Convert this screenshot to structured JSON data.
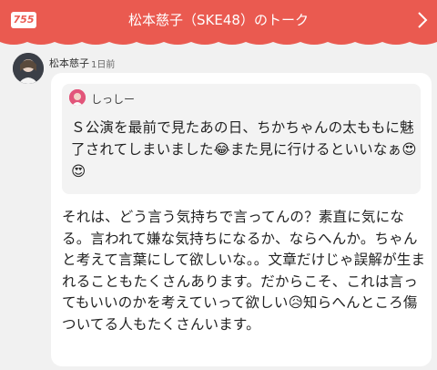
{
  "header": {
    "logo_text": "755",
    "title": "松本慈子（SKE48）のトーク"
  },
  "message": {
    "sender": "松本慈子",
    "time": "1日前",
    "quote": {
      "name": "しっしー",
      "text": "Ｓ公演を最前で見たあの日、ちかちゃんの太ももに魅了されてしまいました😂また見に行けるといいなぁ😍😍"
    },
    "reply_text": "それは、どう言う気持ちで言ってんの？素直に気になる。言われて嫌な気持ちになるか、ならへんか。ちゃんと考えて言葉にして欲しいな。。文章だけじゃ誤解が生まれることもたくさんあります。だからこそ、これは言ってもいいのかを考えていって欲しい😥知らへんところ傷ついてる人もたくさんいます。"
  },
  "colors": {
    "header_bg": "#ea5a50",
    "background": "#f1f1f1",
    "bubble": "#ffffff",
    "quote_bg": "#f3f3f3"
  },
  "icons": [
    "755-logo",
    "chevron-right-icon",
    "avatar",
    "quote-avatar"
  ]
}
